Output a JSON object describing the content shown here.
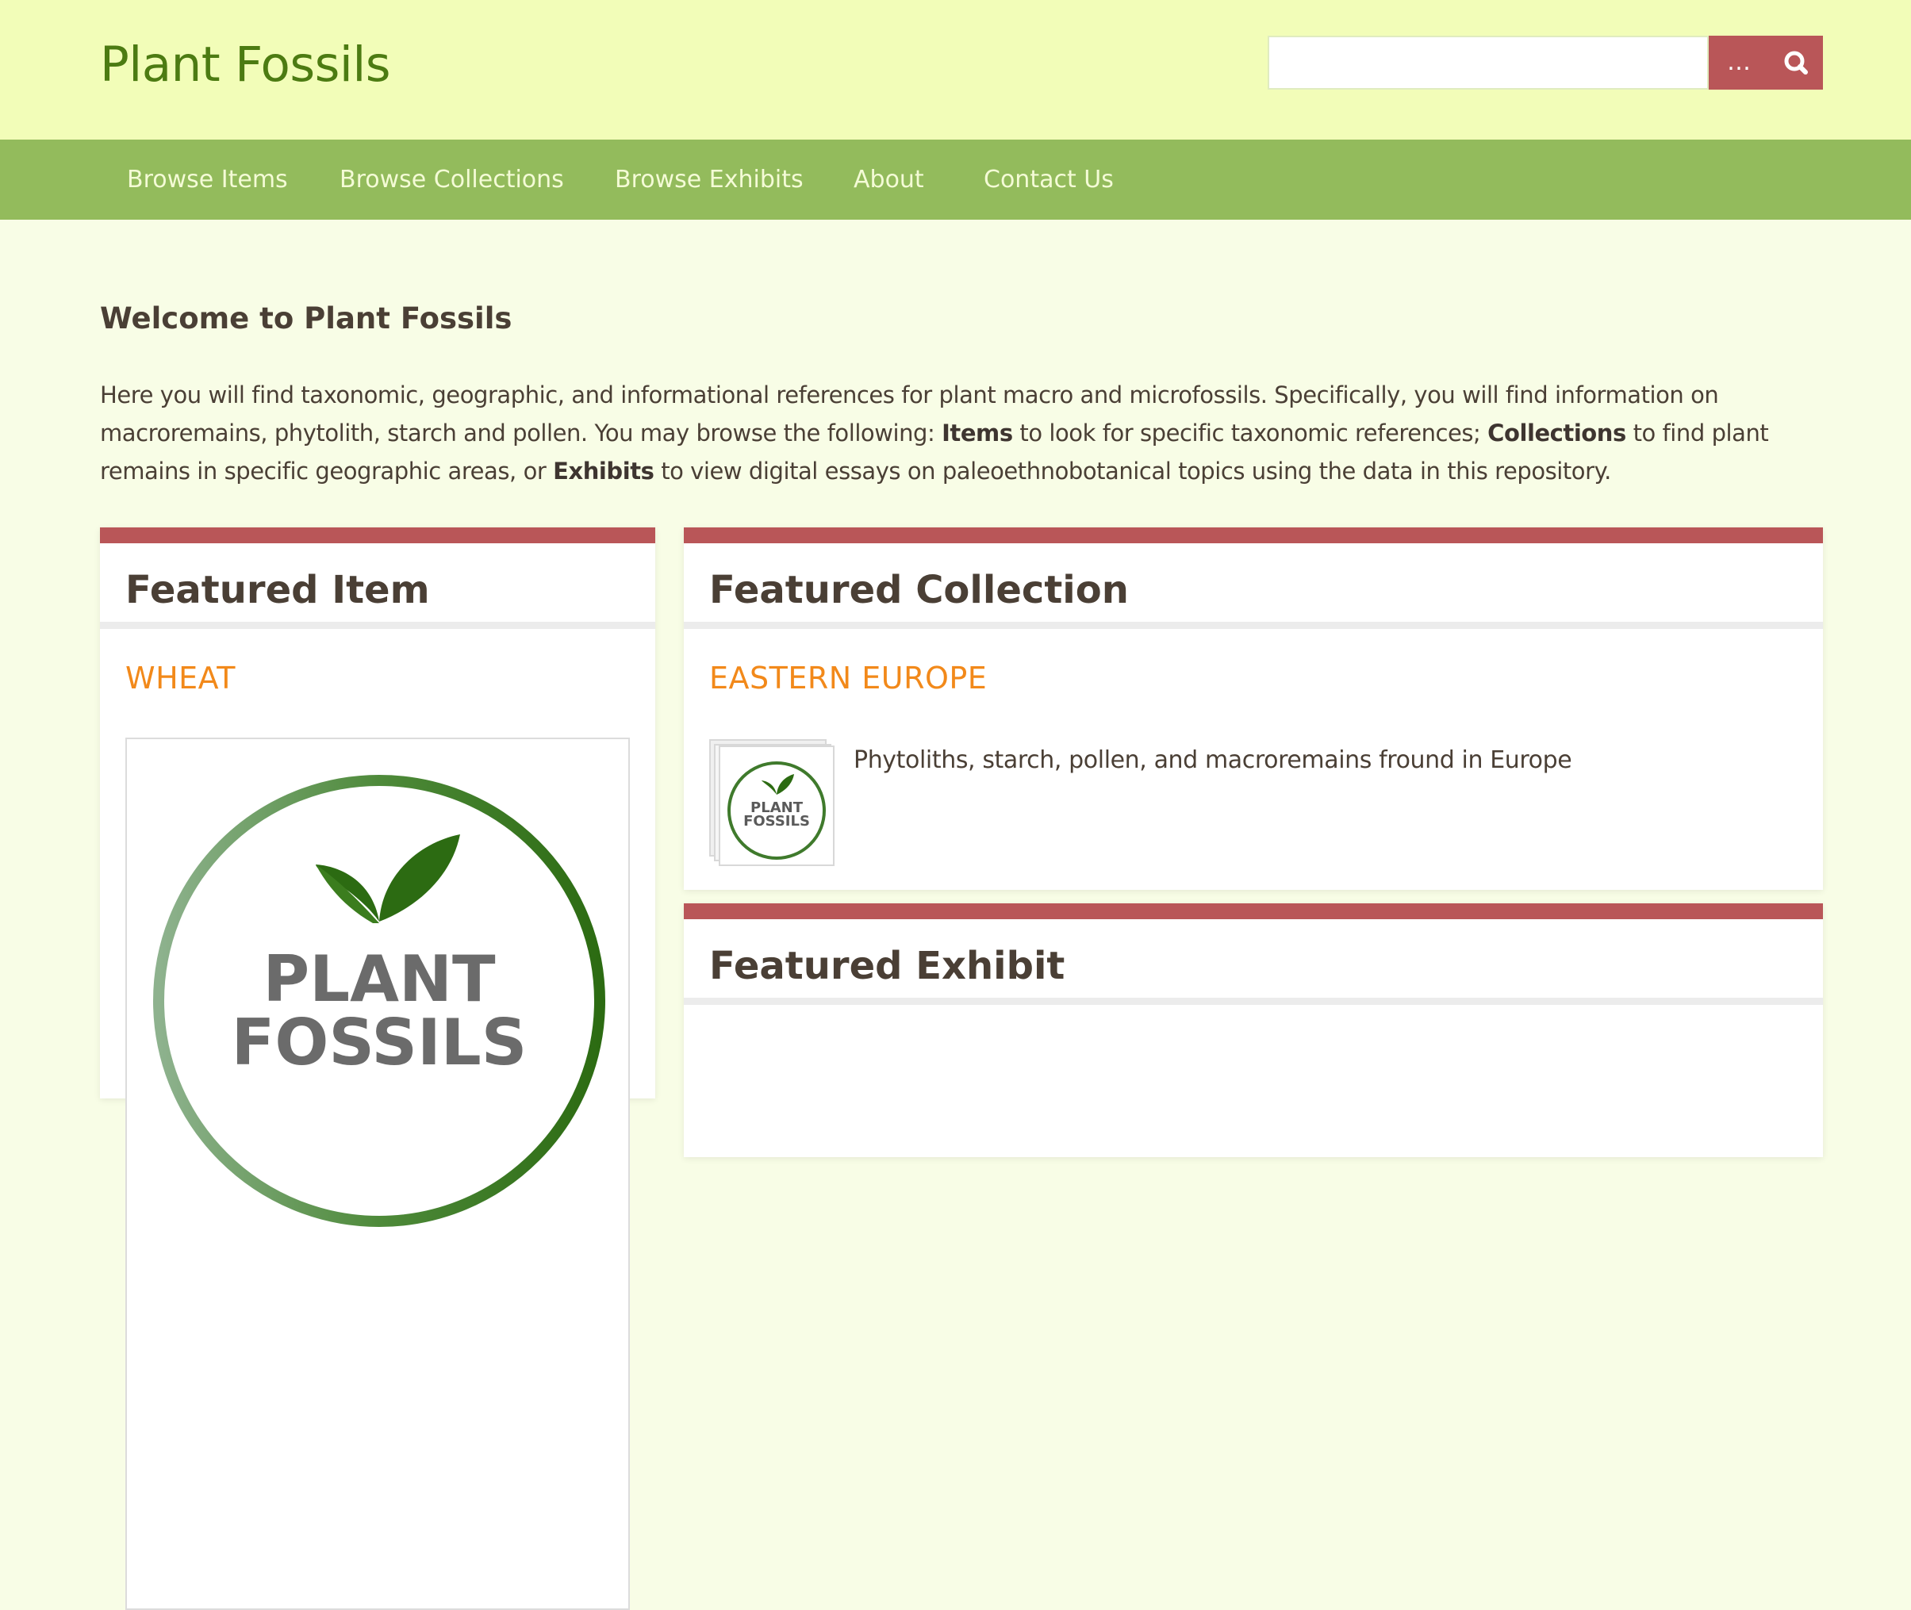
{
  "header": {
    "site_title": "Plant Fossils",
    "search": {
      "placeholder": "",
      "value": "",
      "advanced_label": "…",
      "submit_icon": "search-icon"
    }
  },
  "nav": {
    "items": [
      {
        "label": "Browse Items"
      },
      {
        "label": "Browse Collections"
      },
      {
        "label": "Browse Exhibits"
      },
      {
        "label": "About"
      },
      {
        "label": "Contact Us"
      }
    ]
  },
  "intro": {
    "title": "Welcome to Plant Fossils",
    "text_1": "Here you will find taxonomic, geographic, and informational references for plant macro and microfossils. Specifically, you will find information on macroremains, phytolith, starch and pollen. You may browse the following: ",
    "items_bold": "Items",
    "text_2": " to look for specific taxonomic references; ",
    "collections_bold": "Collections",
    "text_3": " to find plant remains in specific geographic areas, or ",
    "exhibits_bold": "Exhibits",
    "text_4": " to view digital essays on paleoethnobotanical topics using the data in this repository."
  },
  "featured_item": {
    "heading": "Featured Item",
    "title": "WHEAT",
    "logo_text_line1": "PLANT",
    "logo_text_line2": "FOSSILS"
  },
  "featured_collection": {
    "heading": "Featured Collection",
    "title": "EASTERN EUROPE",
    "description": "Phytoliths, starch, pollen, and macroremains fround in Europe",
    "logo_text_line1": "PLANT",
    "logo_text_line2": "FOSSILS"
  },
  "featured_exhibit": {
    "heading": "Featured Exhibit"
  },
  "colors": {
    "header_bg": "#f2fdb8",
    "nav_bg": "#93bb5c",
    "accent_red": "#b95658",
    "link_orange": "#f2891a",
    "title_green": "#4c7b12",
    "page_bg": "#f8fde6"
  }
}
